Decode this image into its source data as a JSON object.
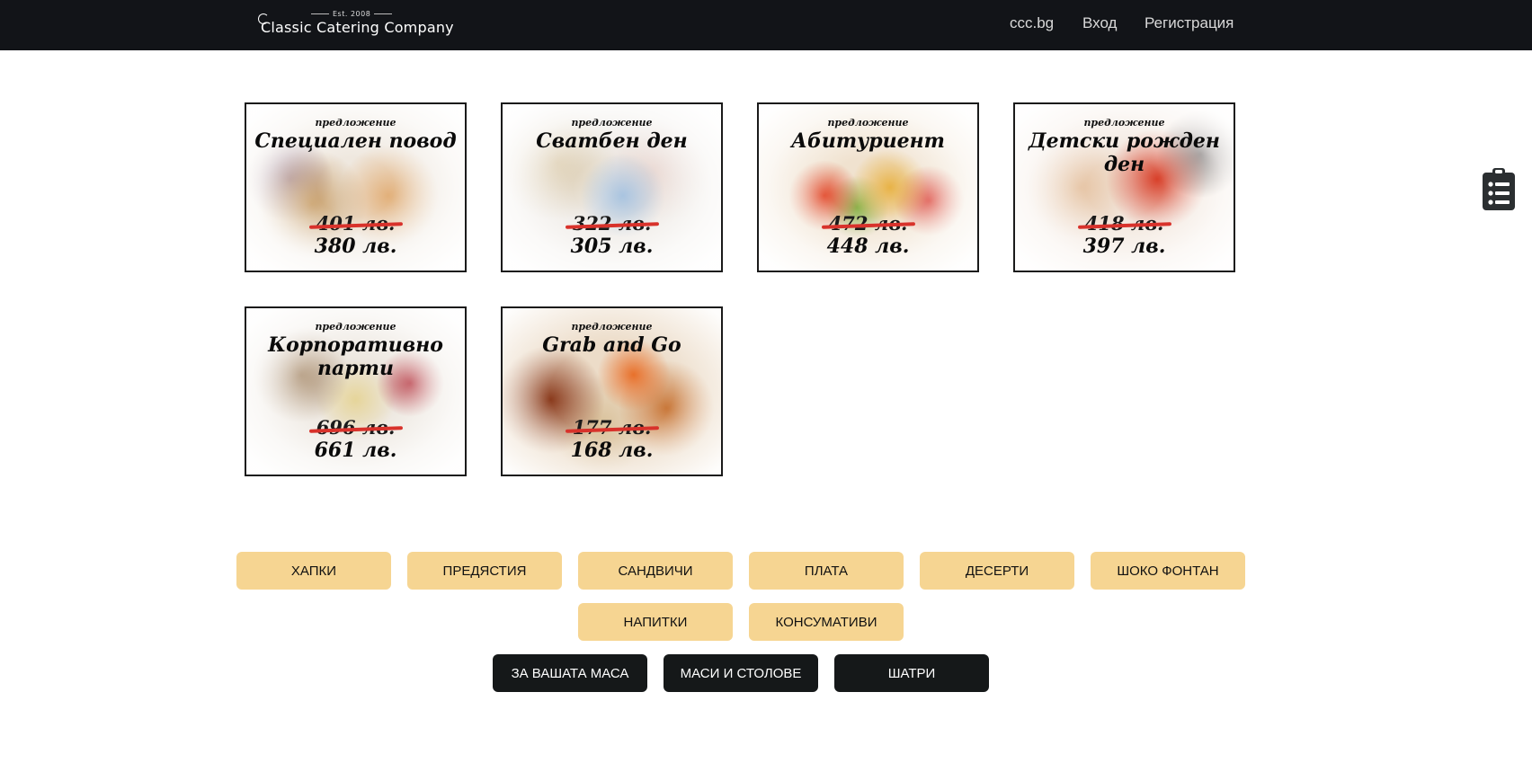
{
  "header": {
    "logo_est": "Est. 2008",
    "logo_name": "Classic Catering Company",
    "nav": [
      "ccc.bg",
      "Вход",
      "Регистрация"
    ]
  },
  "offers": [
    {
      "label": "предложение",
      "title": "Специален повод",
      "old_price": "401 лв.",
      "new_price": "380 лв."
    },
    {
      "label": "предложение",
      "title": "Сватбен ден",
      "old_price": "322 лв.",
      "new_price": "305 лв."
    },
    {
      "label": "предложение",
      "title": "Абитуриент",
      "old_price": "472 лв.",
      "new_price": "448 лв."
    },
    {
      "label": "предложение",
      "title": "Детски рожден ден",
      "old_price": "418 лв.",
      "new_price": "397 лв."
    },
    {
      "label": "предложение",
      "title": "Корпоративно парти",
      "old_price": "696 лв.",
      "new_price": "661 лв."
    },
    {
      "label": "предложение",
      "title": "Grab and Go",
      "old_price": "177 лв.",
      "new_price": "168 лв."
    }
  ],
  "categories": [
    "ХАПКИ",
    "ПРЕДЯСТИЯ",
    "САНДВИЧИ",
    "ПЛАТА",
    "ДЕСЕРТИ",
    "ШОКО ФОНТАН",
    "НАПИТКИ",
    "КОНСУМАТИВИ"
  ],
  "extras": [
    "ЗА ВАШАТА МАСА",
    "МАСИ И СТОЛОВЕ",
    "ШАТРИ"
  ],
  "side_icon": "clipboard-list-icon",
  "colors": {
    "header_bg": "#121418",
    "gold_button": "#f6d592",
    "dark_button": "#151819",
    "price_strike": "#d8322b"
  }
}
